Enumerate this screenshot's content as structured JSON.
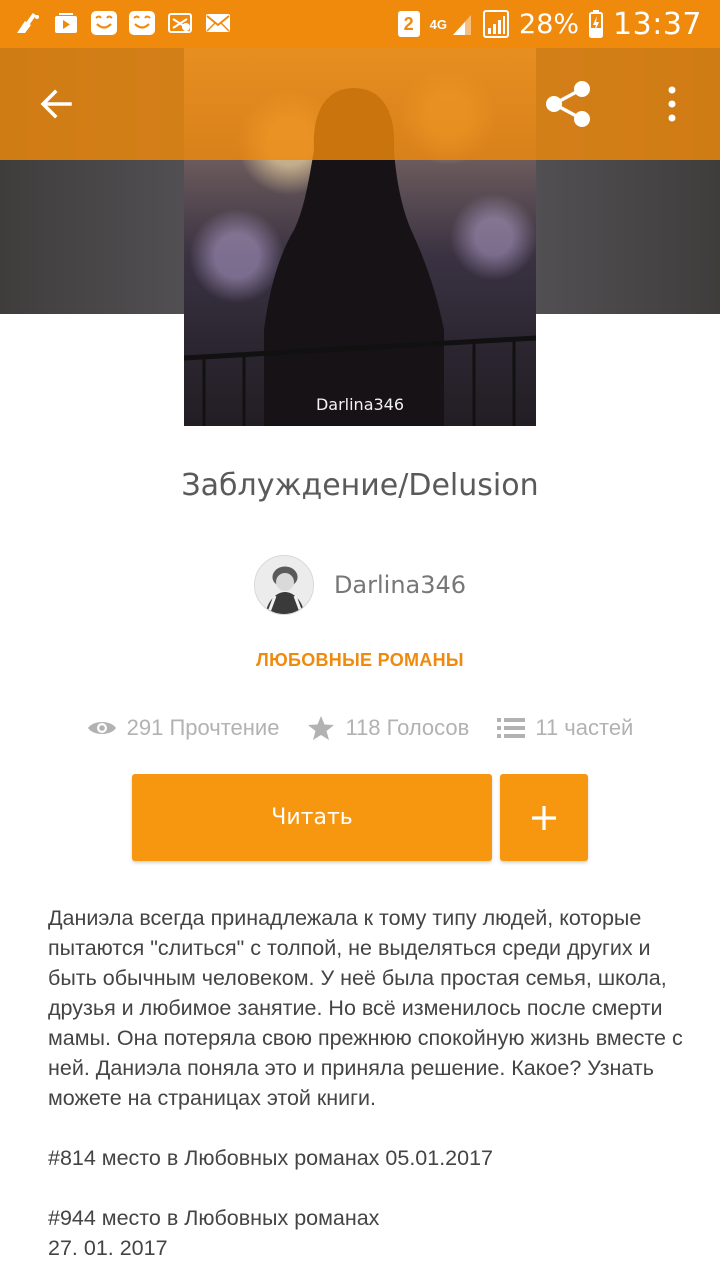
{
  "status_bar": {
    "battery_percent": "28%",
    "time": "13:37",
    "sim_badge": "2",
    "network": "4G",
    "notification_icons": [
      "cleaner-icon",
      "media-icon",
      "smile-icon",
      "smile-icon",
      "settings-icon",
      "mail-icon"
    ]
  },
  "toolbar": {
    "back_icon": "arrow-back-icon",
    "share_icon": "share-icon",
    "more_icon": "more-vert-icon"
  },
  "cover": {
    "author_caption": "Darlina346"
  },
  "story": {
    "title": "Заблуждение/Delusion",
    "author": "Darlina346",
    "genre": "ЛЮБОВНЫЕ РОМАНЫ",
    "stats": {
      "reads": "291 Прочтение",
      "votes": "118 Голосов",
      "parts": "11 частей"
    },
    "read_button": "Читать",
    "description": "Даниэла всегда принадлежала к тому типу людей, которые пытаются \"слиться\" с толпой, не выделяться среди других и быть обычным человеком. У неё была простая семья, школа, друзья и любимое занятие. Но всё изменилось после смерти мамы. Она потеряла свою прежнюю спокойную жизнь вместе с ней. Даниэла поняла это и приняла решение. Какое? Узнать можете на страницах этой книги.",
    "ranking_1": "#814  место в Любовных романах 05.01.2017",
    "ranking_2_line1": "#944  место в Любовных романах",
    "ranking_2_line2": "27. 01. 2017"
  },
  "colors": {
    "accent": "#f08a0c",
    "button": "#f7960f",
    "muted": "#b2b2b2"
  }
}
